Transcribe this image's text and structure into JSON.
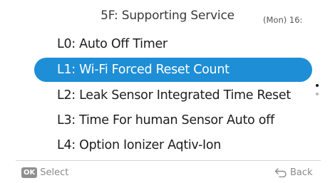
{
  "header": {
    "title": "5F: Supporting Service",
    "clock": "(Mon) 16:"
  },
  "menu": {
    "items": [
      {
        "label": "L0: Auto Off Timer",
        "selected": false
      },
      {
        "label": "L1: Wi-Fi Forced Reset Count",
        "selected": true
      },
      {
        "label": "L2: Leak Sensor Integrated Time Reset",
        "selected": false
      },
      {
        "label": "L3: Time For human Sensor Auto off",
        "selected": false
      },
      {
        "label": "L4: Option Ionizer Aqtiv-Ion",
        "selected": false
      }
    ]
  },
  "scroll": {
    "page_count": 2,
    "current_page": 1
  },
  "footer": {
    "ok_badge": "OK",
    "select_label": "Select",
    "back_label": "Back",
    "back_icon": "back-arrow-icon"
  },
  "colors": {
    "selection": "#1e8ed6",
    "text": "#1d1d1d",
    "hint": "#8a8a8a"
  }
}
